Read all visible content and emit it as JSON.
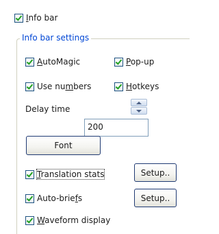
{
  "info_bar": {
    "label": "Info bar",
    "checked": true
  },
  "group": {
    "title": "Info bar settings"
  },
  "options": {
    "automagic": {
      "label": "AutoMagic",
      "checked": true
    },
    "popup": {
      "label": "Pop-up",
      "checked": true
    },
    "use_numbers": {
      "label": "Use numbers",
      "checked": true
    },
    "hotkeys": {
      "label": "Hotkeys",
      "checked": true
    }
  },
  "delay": {
    "label": "Delay time",
    "value": "200"
  },
  "font_button": {
    "label": "Font"
  },
  "translation_stats": {
    "label": "Translation stats",
    "checked": true,
    "setup_label": "Setup.."
  },
  "auto_briefs": {
    "label": "Auto-briefs",
    "checked": true,
    "setup_label": "Setup.."
  },
  "waveform": {
    "label": "Waveform display",
    "checked": true
  }
}
